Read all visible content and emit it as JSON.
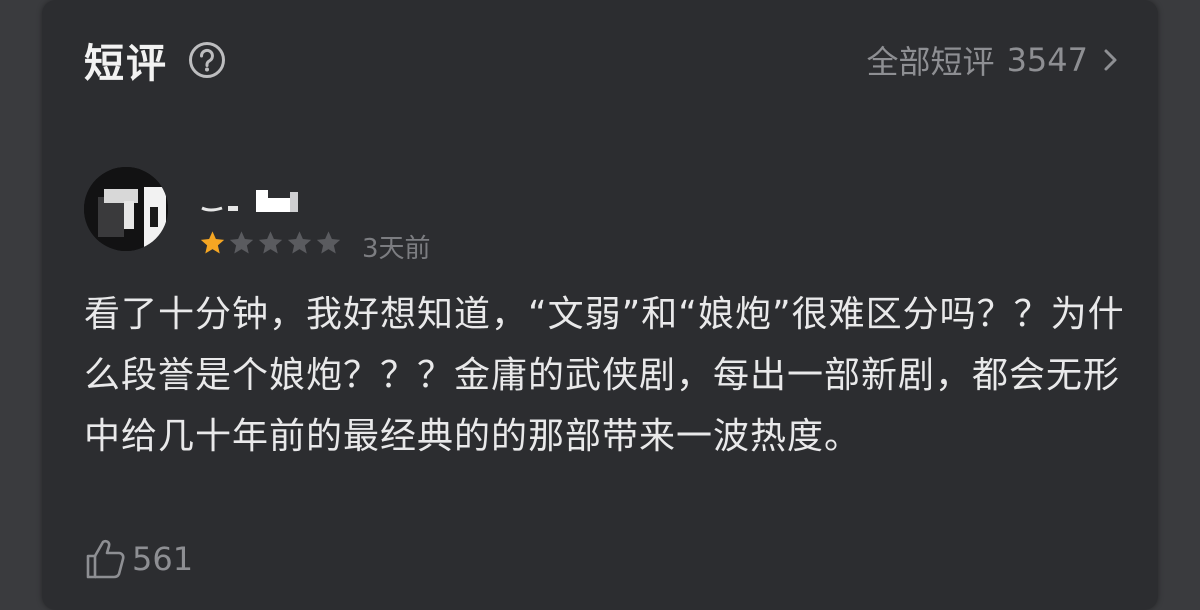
{
  "header": {
    "title": "短评",
    "help_icon": "question-circle-icon",
    "all_label": "全部短评",
    "all_count": "3547",
    "chevron_icon": "chevron-right-icon"
  },
  "review": {
    "avatar_icon": "avatar-image",
    "username": "",
    "rating": 1,
    "rating_max": 5,
    "time": "3天前",
    "text": "看了十分钟，我好想知道，“文弱”和“娘炮”很难区分吗？？为什么段誉是个娘炮？？？金庸的武侠剧，每出一部新剧，都会无形中给几十年前的最经典的的那部带来一波热度。",
    "likes": "561",
    "like_icon": "thumbs-up-icon"
  },
  "colors": {
    "card_bg": "#2c2d30",
    "star_active": "#f5a623",
    "star_inactive": "#5a5b5f",
    "muted_text": "#8e8f93"
  }
}
